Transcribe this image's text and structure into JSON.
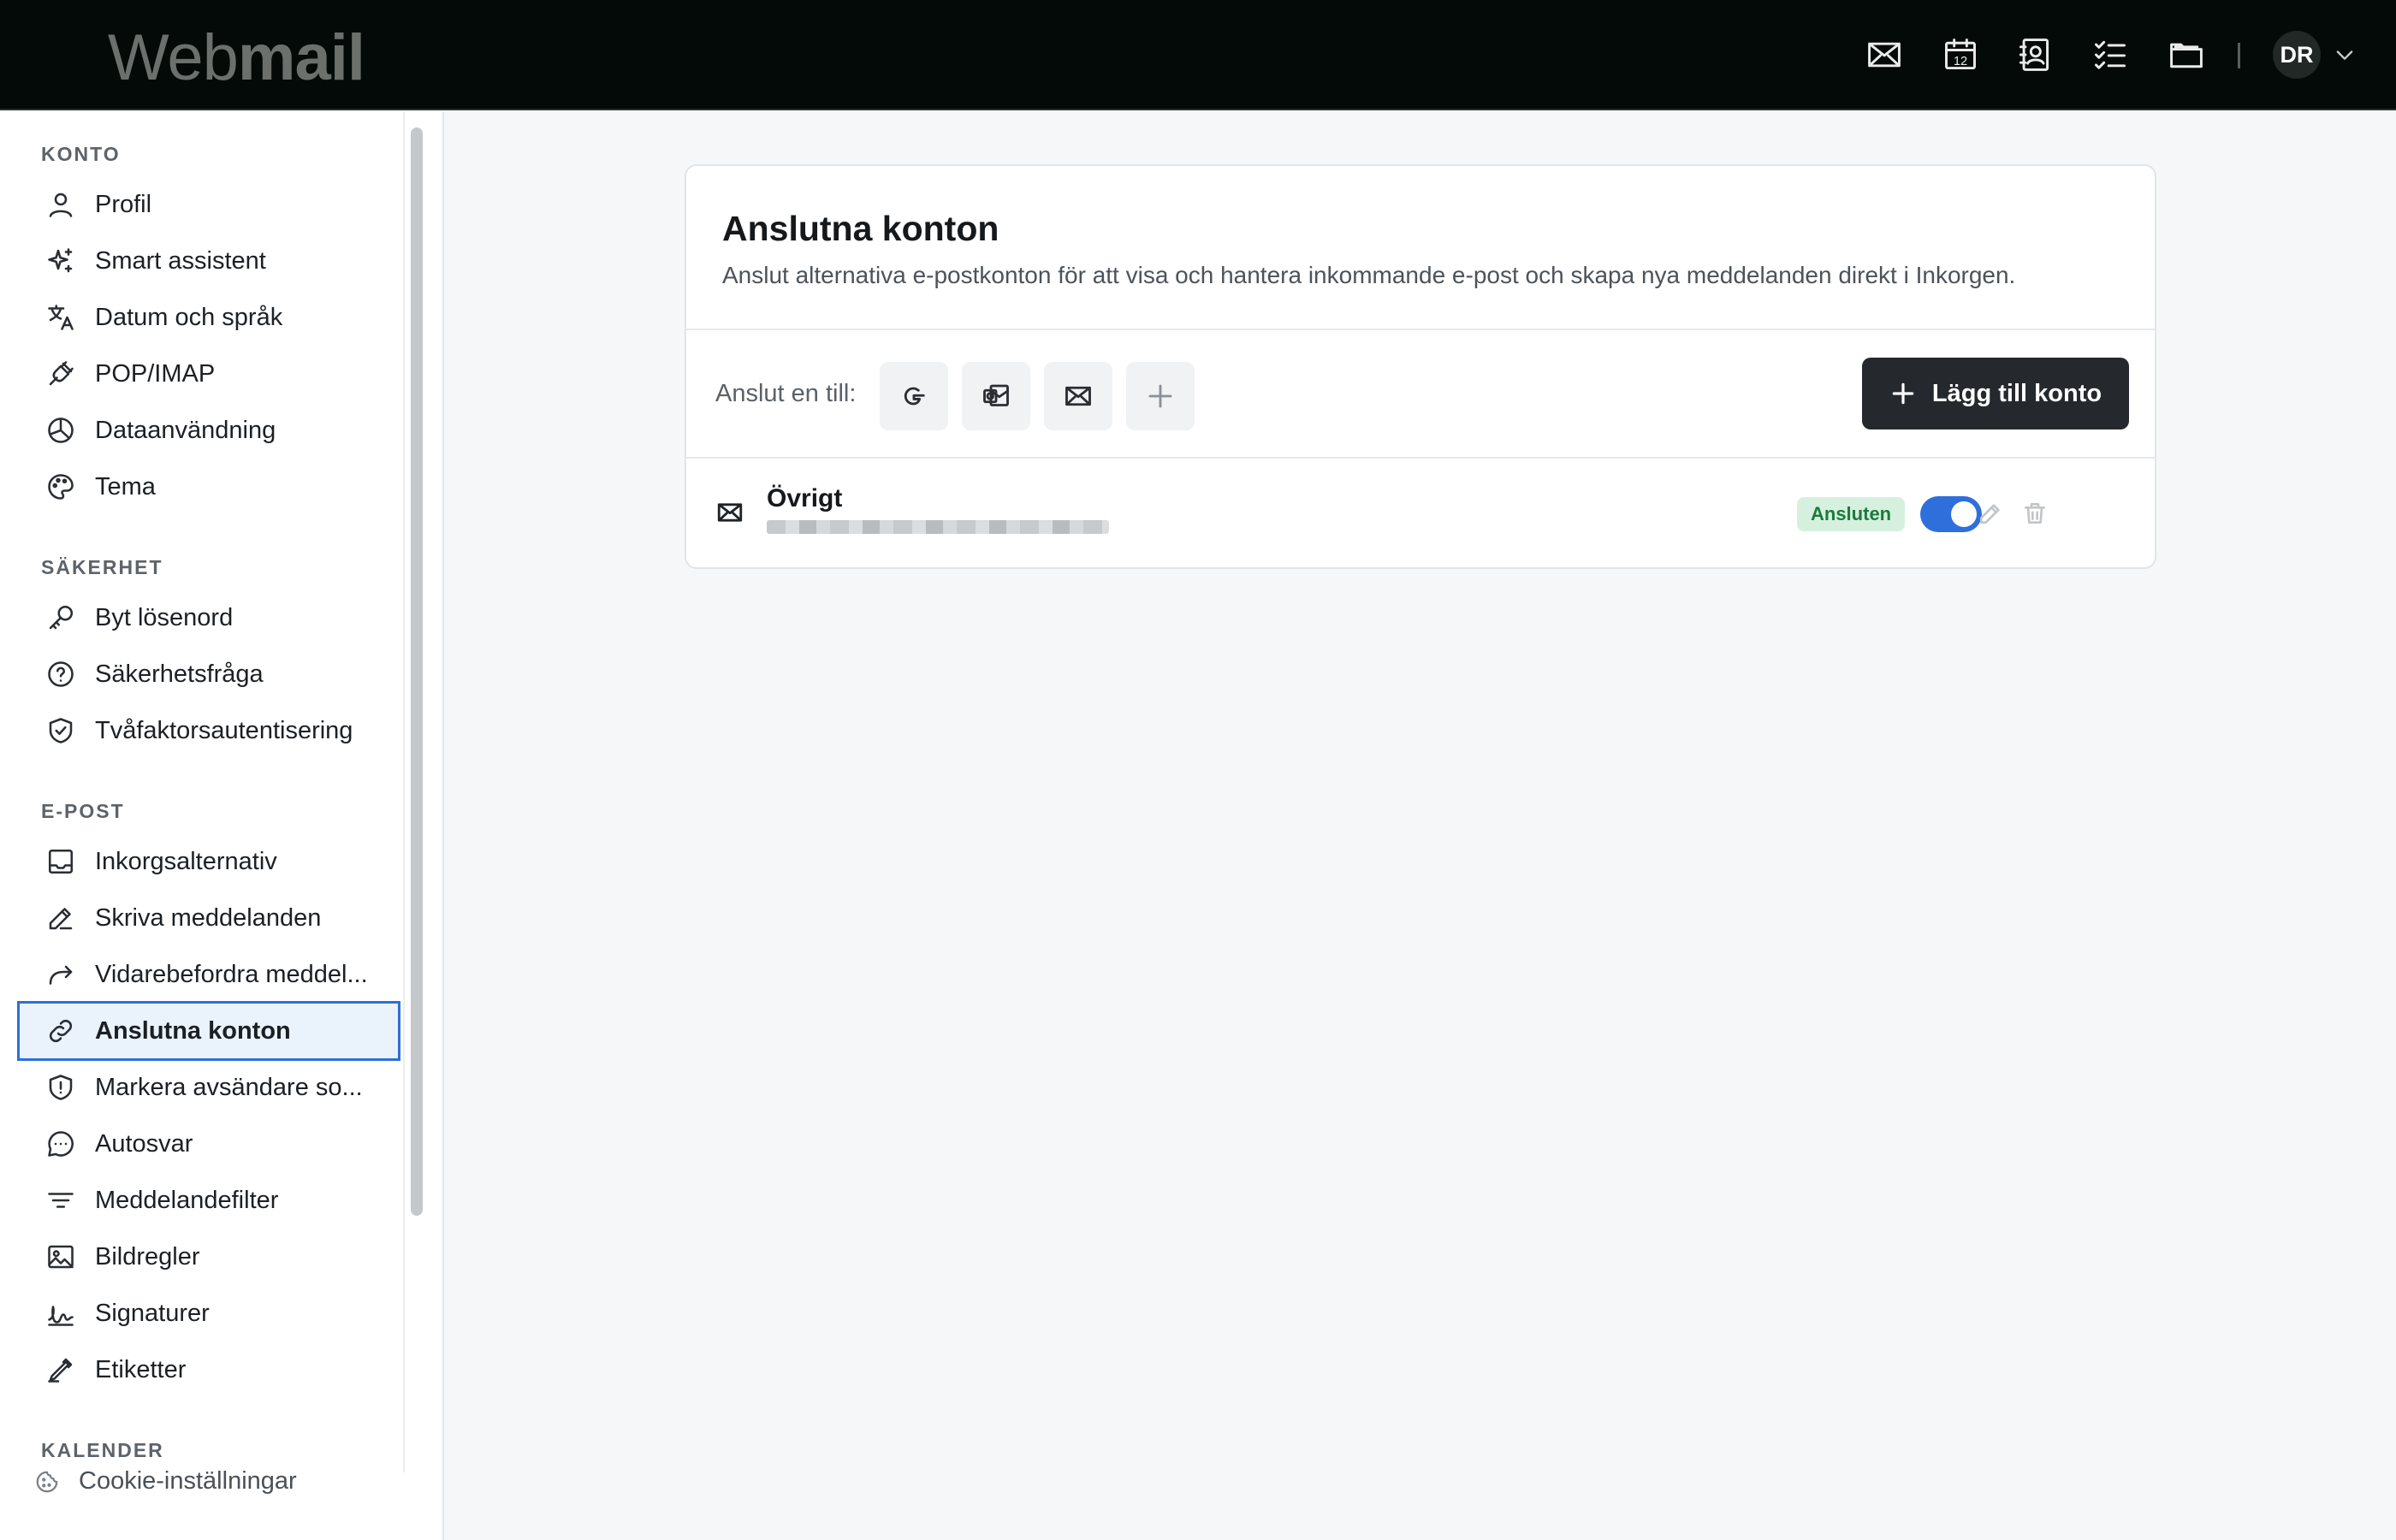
{
  "header": {
    "logo_part1": "Web",
    "logo_part2": "mail",
    "calendar_day": "12",
    "avatar_initials": "DR"
  },
  "sidebar": {
    "konto_title": "KONTO",
    "konto": [
      "Profil",
      "Smart assistent",
      "Datum och språk",
      "POP/IMAP",
      "Dataanvändning",
      "Tema"
    ],
    "sakerhet_title": "SÄKERHET",
    "sakerhet": [
      "Byt lösenord",
      "Säkerhetsfråga",
      "Tvåfaktorsautentisering"
    ],
    "epost_title": "E-POST",
    "epost": [
      "Inkorgsalternativ",
      "Skriva meddelanden",
      "Vidarebefordra meddel...",
      "Anslutna konton",
      "Markera avsändare so...",
      "Autosvar",
      "Meddelandefilter",
      "Bildregler",
      "Signaturer",
      "Etiketter"
    ],
    "kalender_title": "KALENDER",
    "active_item": "Anslutna konton",
    "cookie_label": "Cookie-inställningar"
  },
  "main": {
    "title": "Anslutna konton",
    "description": "Anslut alternativa e-postkonton för att visa och hantera inkommande e-post och skapa nya meddelanden direkt i Inkorgen.",
    "connect_label": "Anslut en till:",
    "add_button_label": "Lägg till konto",
    "account": {
      "name": "Övrigt",
      "status": "Ansluten",
      "enabled": true
    }
  },
  "colors": {
    "topbar_bg": "#030a08",
    "accent": "#2f6fdc",
    "status_green_bg": "#d6f0de",
    "status_green_text": "#1c7a3c",
    "primary_button": "#25292d"
  }
}
